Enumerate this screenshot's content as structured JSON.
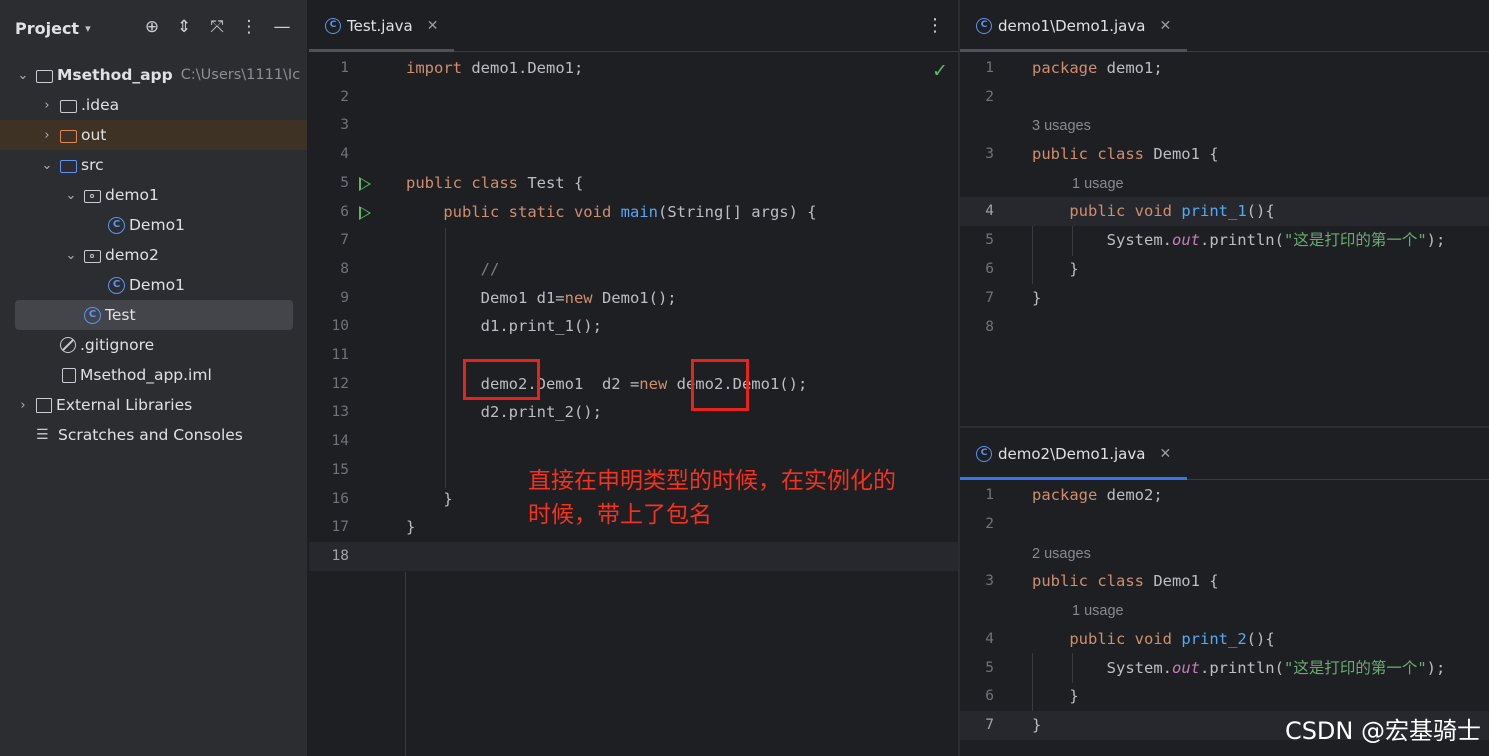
{
  "sidebar": {
    "title": "Project",
    "tree": [
      {
        "label": "Msethod_app",
        "path": "C:\\Users\\1111\\Ic"
      },
      {
        "label": ".idea"
      },
      {
        "label": "out"
      },
      {
        "label": "src"
      },
      {
        "label": "demo1"
      },
      {
        "label": "Demo1"
      },
      {
        "label": "demo2"
      },
      {
        "label": "Demo1"
      },
      {
        "label": "Test"
      },
      {
        "label": ".gitignore"
      },
      {
        "label": "Msethod_app.iml"
      },
      {
        "label": "External Libraries"
      },
      {
        "label": "Scratches and Consoles"
      }
    ]
  },
  "left_editor": {
    "tab": "Test.java",
    "line_numbers": [
      "1",
      "2",
      "3",
      "4",
      "5",
      "6",
      "7",
      "8",
      "9",
      "10",
      "11",
      "12",
      "13",
      "14",
      "15",
      "16",
      "17",
      "18"
    ]
  },
  "right_top_editor": {
    "tab": "demo1\\Demo1.java",
    "hint_usages_class": "3 usages",
    "hint_usages_method": "1 usage",
    "line_numbers": [
      "1",
      "2",
      "3",
      "4",
      "5",
      "6",
      "7",
      "8"
    ]
  },
  "right_bottom_editor": {
    "tab": "demo2\\Demo1.java",
    "hint_usages_class": "2 usages",
    "hint_usages_method": "1 usage",
    "line_numbers": [
      "1",
      "2",
      "3",
      "4",
      "5",
      "6",
      "7"
    ]
  },
  "annotation": {
    "line1": "直接在申明类型的时候，在实例化的",
    "line2": "时候，带上了包名"
  },
  "watermark": "CSDN @宏基骑士",
  "colors": {
    "accent": "#3574f0",
    "keyword": "#cf8e6d",
    "function": "#56a8f5",
    "string": "#6aab73",
    "annotation_red": "#e8231b"
  }
}
